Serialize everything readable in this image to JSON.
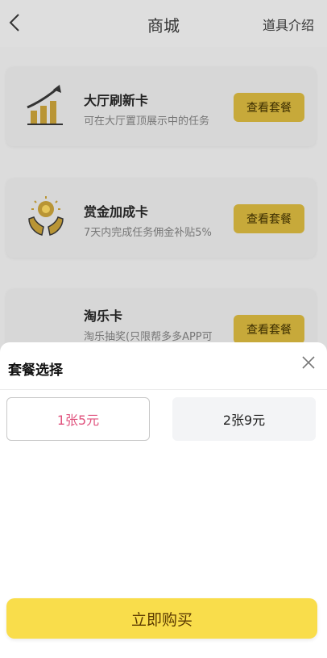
{
  "header": {
    "title": "商城",
    "help_link": "道具介绍"
  },
  "cards": [
    {
      "name": "大厅刷新卡",
      "desc": "可在大厅置顶展示中的任务",
      "button": "查看套餐",
      "icon": "bar-growth-icon"
    },
    {
      "name": "赏金加成卡",
      "desc": "7天内完成任务佣金补贴5%",
      "button": "查看套餐",
      "icon": "hands-coin-icon"
    },
    {
      "name": "淘乐卡",
      "desc": "淘乐抽奖(只限帮多多APP可",
      "button": "查看套餐",
      "icon": ""
    }
  ],
  "sheet": {
    "title": "套餐选择",
    "options": [
      {
        "label": "1张5元",
        "selected": true
      },
      {
        "label": "2张9元",
        "selected": false
      }
    ],
    "buy_button": "立即购买"
  },
  "colors": {
    "accent_yellow": "#f9dd4b",
    "selected_text": "#e0537e"
  }
}
